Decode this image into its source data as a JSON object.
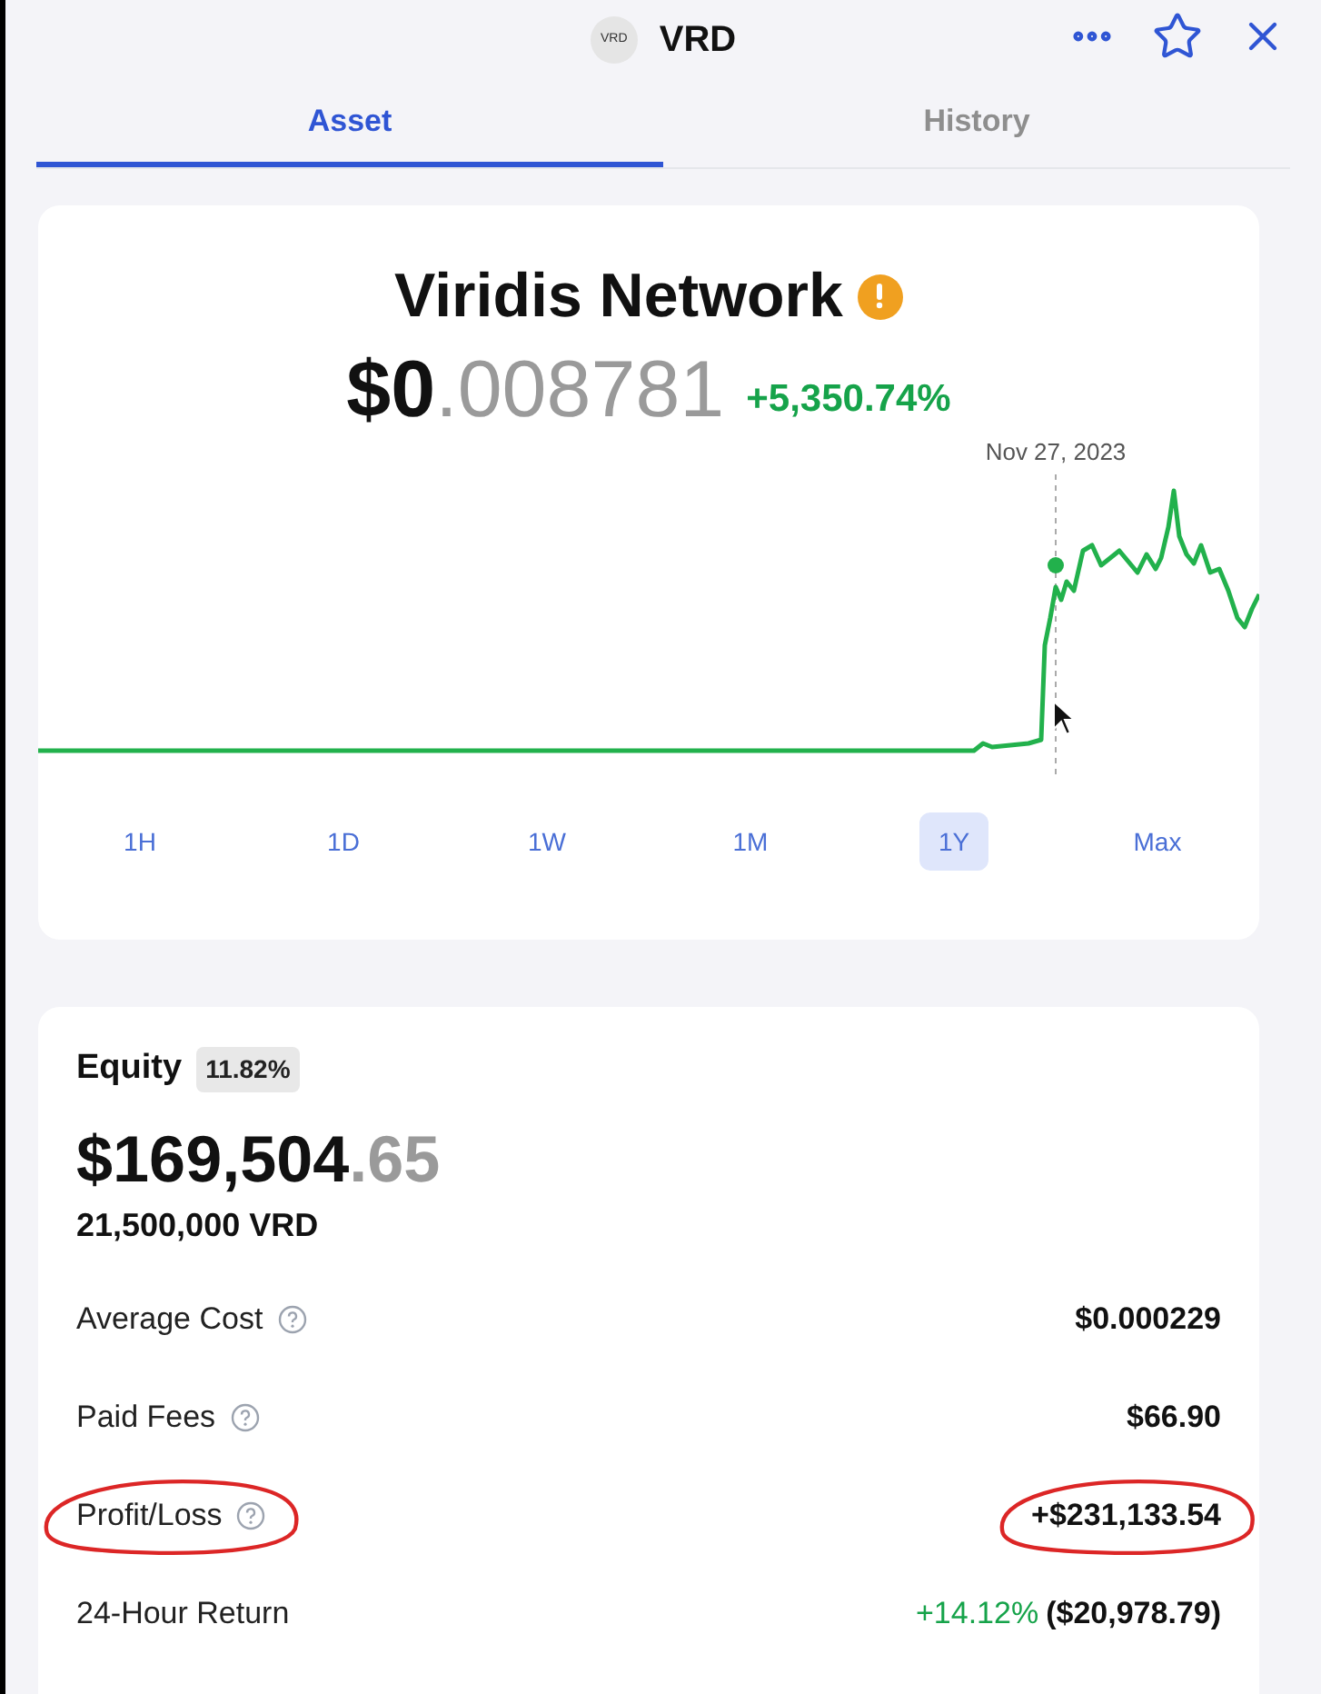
{
  "header": {
    "logo": "VRD",
    "symbol": "VRD"
  },
  "tabs": [
    {
      "label": "Asset",
      "selected": true
    },
    {
      "label": "History",
      "selected": false
    }
  ],
  "asset": {
    "name": "Viridis Network",
    "warning": true,
    "price_whole": "$0",
    "price_fraction": ".008781",
    "change": "+5,350.74%",
    "hover_date": "Nov 27, 2023"
  },
  "ranges": [
    {
      "label": "1H",
      "selected": false
    },
    {
      "label": "1D",
      "selected": false
    },
    {
      "label": "1W",
      "selected": false
    },
    {
      "label": "1M",
      "selected": false
    },
    {
      "label": "1Y",
      "selected": true
    },
    {
      "label": "Max",
      "selected": false
    }
  ],
  "equity": {
    "label": "Equity",
    "share": "11.82%",
    "value_whole": "$169,504",
    "value_fraction": ".65",
    "quantity": "21,500,000 VRD"
  },
  "stats": [
    {
      "kind": "plain",
      "label": "Average Cost",
      "help": true,
      "value": "$0.000229",
      "circled": false
    },
    {
      "kind": "plain",
      "label": "Paid Fees",
      "help": true,
      "value": "$66.90",
      "circled": false
    },
    {
      "kind": "plain",
      "label": "Profit/Loss",
      "help": true,
      "value": "+$231,133.54",
      "circled": true
    },
    {
      "kind": "return",
      "label": "24-Hour Return",
      "help": false,
      "change": "+14.12%",
      "value": "($20,978.79)",
      "circled": false
    }
  ]
}
